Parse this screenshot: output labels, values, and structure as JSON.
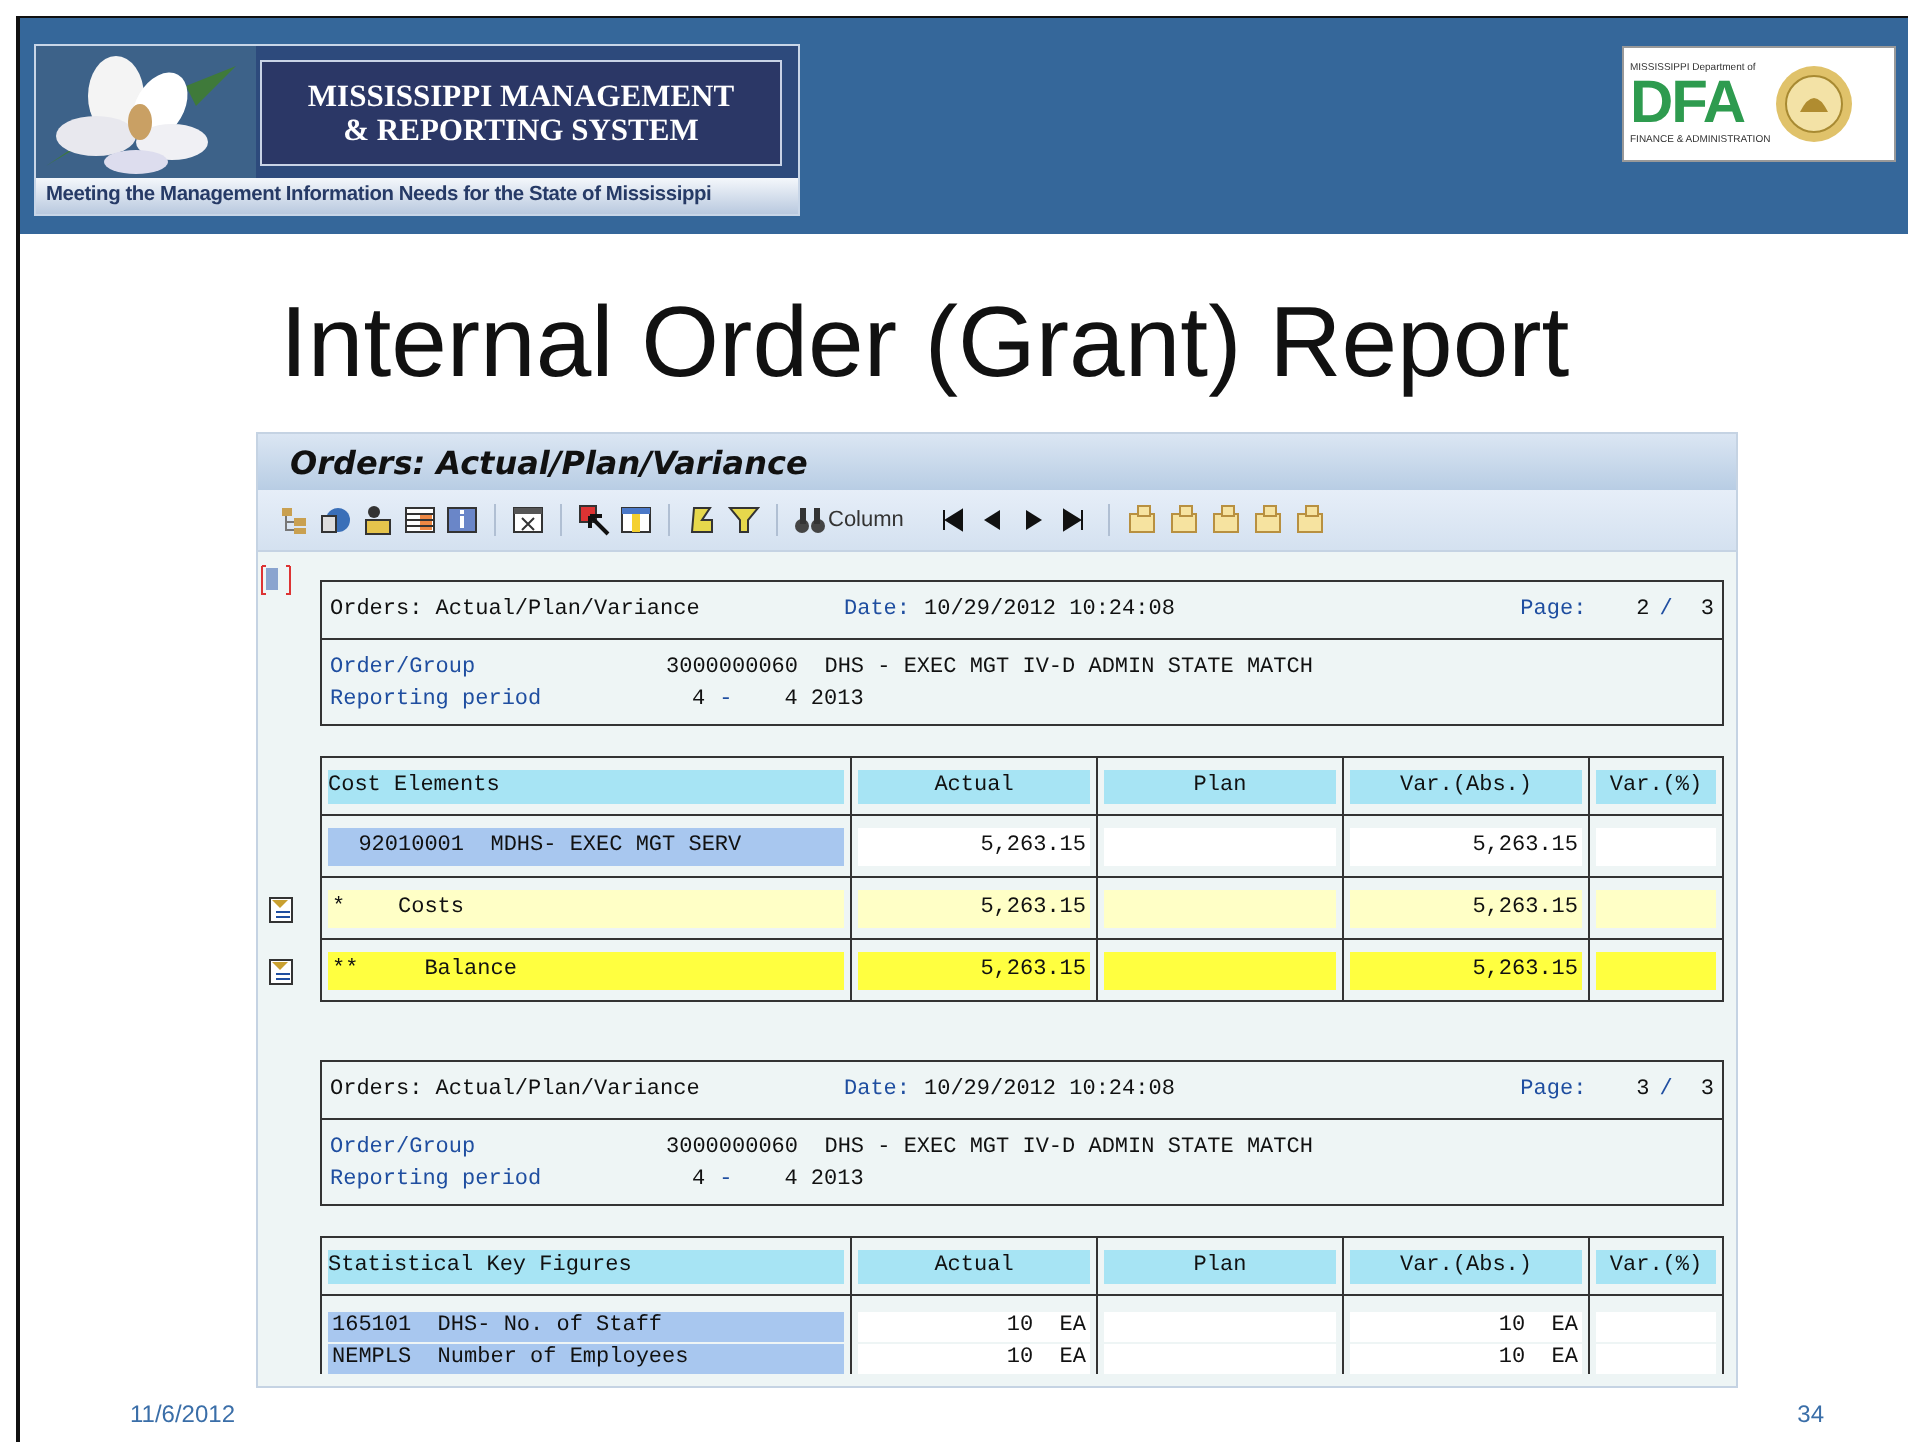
{
  "banner": {
    "title_line_1": "MISSISSIPPI MANAGEMENT",
    "title_line_2": "& REPORTING SYSTEM",
    "tagline": "Meeting the Management Information Needs for the State of Mississippi"
  },
  "agency_logo": {
    "top_text": "MISSISSIPPI Department of",
    "letters": "DFA",
    "bottom_text": "FINANCE & ADMINISTRATION"
  },
  "slide_title": "Internal Order (Grant) Report",
  "sap_window": {
    "title": "Orders: Actual/Plan/Variance",
    "column_button": "Column",
    "reports": [
      {
        "title": "Orders: Actual/Plan/Variance",
        "date_label": "Date:",
        "date": "10/29/2012 10:24:08",
        "page_label": "Page:",
        "page_current": "2",
        "page_sep": "/",
        "page_total": "3",
        "order_label": "Order/Group",
        "order_value": "3000000060  DHS - EXEC MGT IV-D ADMIN STATE MATCH",
        "period_label": "Reporting period",
        "period_from": "4",
        "period_dash": "-",
        "period_to": "4 2013",
        "columns": [
          "Cost Elements",
          "Actual",
          "Plan",
          "Var.(Abs.)",
          "Var.(%)"
        ],
        "rows": [
          {
            "kind": "item",
            "label": "  92010001  MDHS- EXEC MGT SERV",
            "actual": "5,263.15",
            "var_abs": "5,263.15"
          },
          {
            "kind": "subtotal",
            "label": "*    Costs",
            "actual": "5,263.15",
            "var_abs": "5,263.15"
          },
          {
            "kind": "total",
            "label": "**     Balance",
            "actual": "5,263.15",
            "var_abs": "5,263.15"
          }
        ]
      },
      {
        "title": "Orders: Actual/Plan/Variance",
        "date_label": "Date:",
        "date": "10/29/2012 10:24:08",
        "page_label": "Page:",
        "page_current": "3",
        "page_sep": "/",
        "page_total": "3",
        "order_label": "Order/Group",
        "order_value": "3000000060  DHS - EXEC MGT IV-D ADMIN STATE MATCH",
        "period_label": "Reporting period",
        "period_from": "4",
        "period_dash": "-",
        "period_to": "4 2013",
        "columns": [
          "Statistical Key Figures",
          "Actual",
          "Plan",
          "Var.(Abs.)",
          "Var.(%)"
        ],
        "rows": [
          {
            "kind": "stat",
            "label": "165101  DHS- No. of Staff",
            "actual": "10  EA",
            "var_abs": "10  EA"
          },
          {
            "kind": "stat",
            "label": "NEMPLS  Number of Employees",
            "actual": "10  EA",
            "var_abs": "10  EA"
          }
        ]
      }
    ]
  },
  "footer": {
    "date": "11/6/2012",
    "slide_number": "34"
  }
}
